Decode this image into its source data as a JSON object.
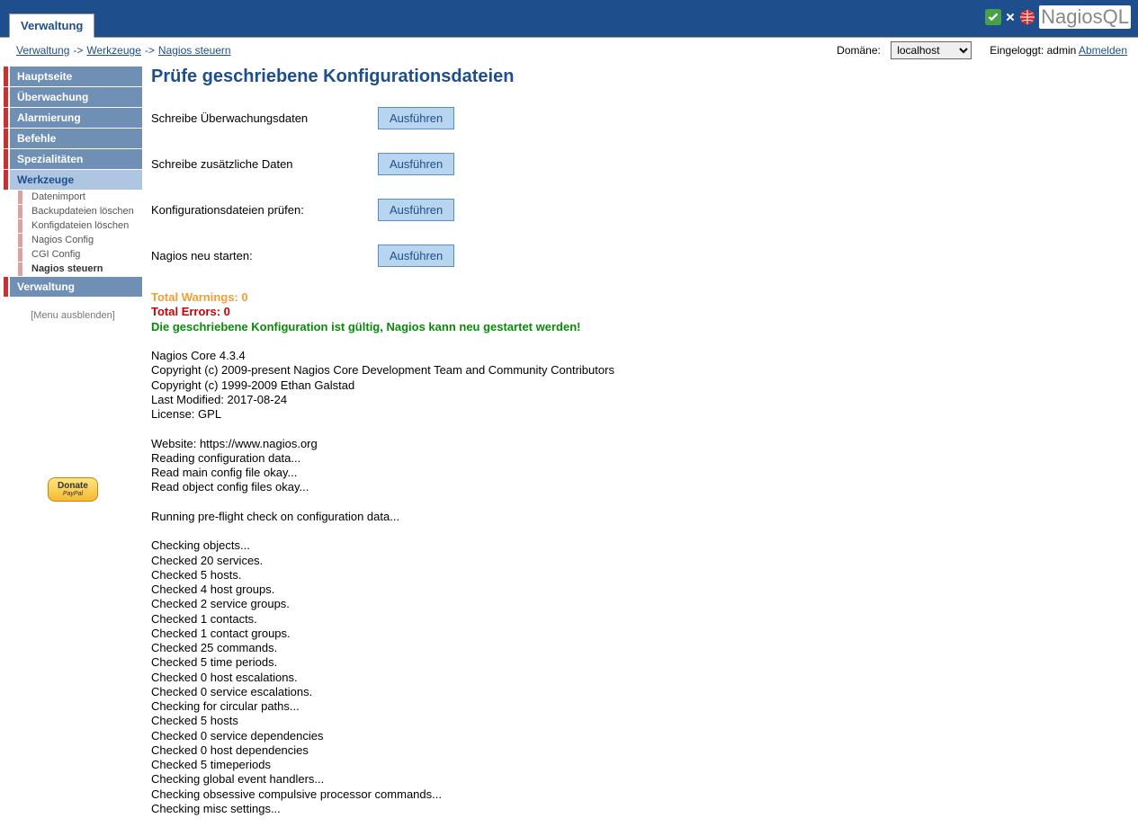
{
  "tab_label": "Verwaltung",
  "logo": {
    "text_part1": "Nagios",
    "text_part2": "QL"
  },
  "breadcrumb": {
    "a": "Verwaltung",
    "b": "Werkzeuge",
    "c": "Nagios steuern"
  },
  "domain": {
    "label": "Domäne:",
    "value": "localhost"
  },
  "login": {
    "prefix": "Eingeloggt: ",
    "user": "admin",
    "logout": "Abmelden"
  },
  "nav": {
    "hauptseite": "Hauptseite",
    "ueberwachung": "Überwachung",
    "alarmierung": "Alarmierung",
    "befehle": "Befehle",
    "spezialitaeten": "Spezialitäten",
    "werkzeuge": "Werkzeuge",
    "verwaltung": "Verwaltung"
  },
  "subnav": {
    "datenimport": "Datenimport",
    "backup_loeschen": "Backupdateien löschen",
    "konfig_loeschen": "Konfigdateien löschen",
    "nagios_config": "Nagios Config",
    "cgi_config": "CGI Config",
    "nagios_steuern": "Nagios steuern"
  },
  "menu_hide": "[Menu ausblenden]",
  "donate": {
    "line1": "Donate",
    "line2": "PayPal"
  },
  "page_title": "Prüfe geschriebene Konfigurationsdateien",
  "actions": {
    "schreibe_ueberwachung": "Schreibe Überwachungsdaten",
    "schreibe_zusatz": "Schreibe zusätzliche Daten",
    "konfig_pruefen": "Konfigurationsdateien prüfen:",
    "nagios_restart": "Nagios neu starten:",
    "button_label": "Ausführen"
  },
  "output": {
    "warnings": "Total Warnings: 0",
    "errors": "Total Errors: 0",
    "valid": "Die geschriebene Konfiguration ist gültig, Nagios kann neu gestartet werden!",
    "lines": [
      "",
      "Nagios Core 4.3.4",
      "Copyright (c) 2009-present Nagios Core Development Team and Community Contributors",
      "Copyright (c) 1999-2009 Ethan Galstad",
      "Last Modified: 2017-08-24",
      "License: GPL",
      "",
      "Website: https://www.nagios.org",
      "Reading configuration data...",
      "Read main config file okay...",
      "Read object config files okay...",
      "",
      "Running pre-flight check on configuration data...",
      "",
      "Checking objects...",
      "Checked 20 services.",
      "Checked 5 hosts.",
      "Checked 4 host groups.",
      "Checked 2 service groups.",
      "Checked 1 contacts.",
      "Checked 1 contact groups.",
      "Checked 25 commands.",
      "Checked 5 time periods.",
      "Checked 0 host escalations.",
      "Checked 0 service escalations.",
      "Checking for circular paths...",
      "Checked 5 hosts",
      "Checked 0 service dependencies",
      "Checked 0 host dependencies",
      "Checked 5 timeperiods",
      "Checking global event handlers...",
      "Checking obsessive compulsive processor commands...",
      "Checking misc settings..."
    ]
  }
}
